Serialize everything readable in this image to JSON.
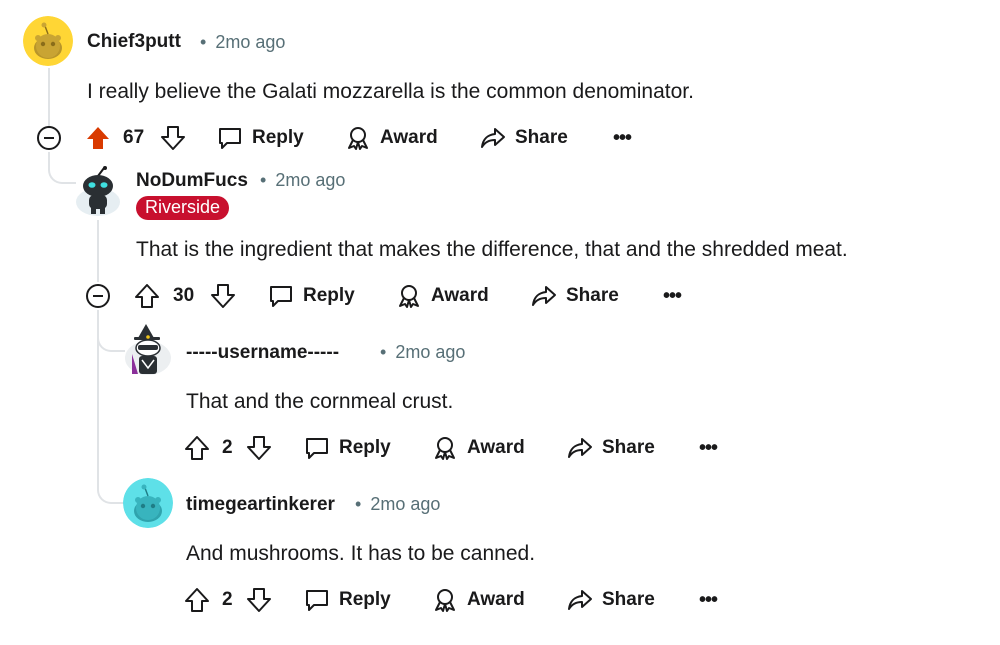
{
  "colors": {
    "accent_upvote": "#d93a00",
    "flair_bg": "#c8102e",
    "meta_text": "#576f76",
    "thread_line": "#e0e3e6"
  },
  "comments": [
    {
      "username": "Chief3putt",
      "dot": "•",
      "time": "2mo ago",
      "body": "I really believe the Galati mozzarella is the common denominator.",
      "votes": "67",
      "upvoted": true,
      "avatar_icon": "snoo-avatar-yellow",
      "actions": {
        "reply": "Reply",
        "award": "Award",
        "share": "Share",
        "more": "•••"
      }
    },
    {
      "username": "NoDumFucs",
      "dot": "•",
      "time": "2mo ago",
      "flair": "Riverside",
      "body": "That is the ingredient that makes the difference, that and the shredded meat.",
      "votes": "30",
      "upvoted": false,
      "avatar_icon": "robot-snoo-avatar",
      "actions": {
        "reply": "Reply",
        "award": "Award",
        "share": "Share",
        "more": "•••"
      }
    },
    {
      "username": "-----username-----",
      "dot": "•",
      "time": "2mo ago",
      "body": "That and the cornmeal crust.",
      "votes": "2",
      "upvoted": false,
      "avatar_icon": "witch-hat-snoo-avatar",
      "actions": {
        "reply": "Reply",
        "award": "Award",
        "share": "Share",
        "more": "•••"
      }
    },
    {
      "username": "timegeartinkerer",
      "dot": "•",
      "time": "2mo ago",
      "body": "And mushrooms. It has to be canned.",
      "votes": "2",
      "upvoted": false,
      "avatar_icon": "snoo-avatar-cyan",
      "actions": {
        "reply": "Reply",
        "award": "Award",
        "share": "Share",
        "more": "•••"
      }
    }
  ]
}
